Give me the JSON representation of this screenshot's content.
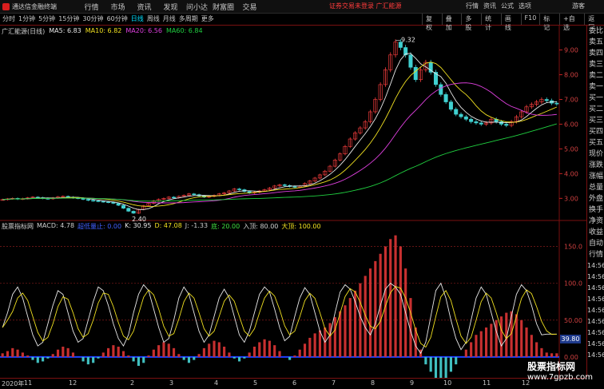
{
  "menubar": {
    "app_name": "通达信金融终端",
    "items": [
      "行情",
      "市场",
      "资讯",
      "发现",
      "问小达",
      "财富圈",
      "交易"
    ],
    "alert": "证券交易未登录",
    "alert2": "广汇能源",
    "right_items": [
      "行情",
      "资讯",
      "公式",
      "选项"
    ],
    "guest": "游客"
  },
  "toolbar": {
    "periods": [
      "分时",
      "1分钟",
      "5分钟",
      "15分钟",
      "30分钟",
      "60分钟",
      "日线",
      "周线",
      "月线",
      "多周期",
      "更多"
    ],
    "active_period": "日线",
    "tools": [
      "复权",
      "叠加",
      "多股",
      "统计",
      "画线",
      "F10",
      "标记",
      "+自选",
      "返回"
    ]
  },
  "legend": {
    "stock_name": "广汇能源(日线)",
    "ma5": "MA5: 6.83",
    "ma10": "MA10: 6.82",
    "ma20": "MA20: 6.56",
    "ma60": "MA60: 6.84"
  },
  "indicator_legend": {
    "title": "股票指标网",
    "macd": "MACD: 4.78",
    "zone": "超低量止: 0.00",
    "k": "K: 30.95",
    "d": "D: 47.08",
    "j": "J: -1.33",
    "bottom": "底: 20.00",
    "entry": "入顶: 80.00",
    "top": "大顶: 100.00"
  },
  "price_axis": [
    {
      "label": "9.00",
      "value": 9
    },
    {
      "label": "8.00",
      "value": 8
    },
    {
      "label": "7.00",
      "value": 7
    },
    {
      "label": "6.00",
      "value": 6
    },
    {
      "label": "5.00",
      "value": 5
    },
    {
      "label": "4.00",
      "value": 4
    },
    {
      "label": "3.00",
      "value": 3
    }
  ],
  "indicator_axis": [
    {
      "label": "150.0",
      "value": 150
    },
    {
      "label": "100.0",
      "value": 100
    },
    {
      "label": "50.00",
      "value": 50
    },
    {
      "label": "0.00",
      "value": 0
    }
  ],
  "annotations": {
    "high": "9.32",
    "low": "2.40",
    "readout": "39.80"
  },
  "side_tabs": [
    "委比",
    "卖五",
    "卖四",
    "卖三",
    "卖二",
    "卖一",
    "买一",
    "买二",
    "买三",
    "买四",
    "买五",
    "现价",
    "涨跌",
    "涨幅",
    "总量",
    "外盘",
    "换手",
    "净资",
    "收益",
    "自动",
    "行情"
  ],
  "side_times": [
    "14:56",
    "14:56",
    "14:56",
    "14:56",
    "14:56",
    "14:56",
    "14:56",
    "14:56",
    "14:56"
  ],
  "date_axis": [
    {
      "label": "2020年",
      "pos": 0.0
    },
    {
      "label": "11",
      "pos": 0.04
    },
    {
      "label": "12",
      "pos": 0.12
    },
    {
      "label": "2",
      "pos": 0.23
    },
    {
      "label": "3",
      "pos": 0.3
    },
    {
      "label": "4",
      "pos": 0.38
    },
    {
      "label": "5",
      "pos": 0.45
    },
    {
      "label": "6",
      "pos": 0.52
    },
    {
      "label": "7",
      "pos": 0.59
    },
    {
      "label": "8",
      "pos": 0.66
    },
    {
      "label": "9",
      "pos": 0.73
    },
    {
      "label": "10",
      "pos": 0.79
    },
    {
      "label": "11",
      "pos": 0.86
    },
    {
      "label": "12",
      "pos": 0.93
    }
  ],
  "watermark": {
    "title": "股票指标网",
    "url": "www.7gpzb.com"
  },
  "chart_data": {
    "type": "line",
    "title": "",
    "price_series": {
      "ylim": [
        2.3,
        9.6
      ],
      "close": [
        2.95,
        2.98,
        3.0,
        2.97,
        2.99,
        3.02,
        3.05,
        3.03,
        3.0,
        2.98,
        3.02,
        3.06,
        3.08,
        3.05,
        3.02,
        3.0,
        2.96,
        2.92,
        2.9,
        2.88,
        2.86,
        2.84,
        2.8,
        2.72,
        2.6,
        2.48,
        2.4,
        2.55,
        2.7,
        2.8,
        2.9,
        2.96,
        3.0,
        3.05,
        3.02,
        3.08,
        3.12,
        3.18,
        3.15,
        3.1,
        3.05,
        3.08,
        3.12,
        3.18,
        3.22,
        3.3,
        3.38,
        3.35,
        3.28,
        3.22,
        3.25,
        3.3,
        3.35,
        3.42,
        3.5,
        3.55,
        3.52,
        3.48,
        3.45,
        3.5,
        3.6,
        3.7,
        3.82,
        3.95,
        4.1,
        4.3,
        4.55,
        4.8,
        5.1,
        5.4,
        5.65,
        5.85,
        6.1,
        6.5,
        7.0,
        7.6,
        8.2,
        8.8,
        9.32,
        9.1,
        8.8,
        8.3,
        7.8,
        8.2,
        8.5,
        8.1,
        7.6,
        7.2,
        6.9,
        6.6,
        6.4,
        6.3,
        6.2,
        6.1,
        6.05,
        6.0,
        6.05,
        6.2,
        6.1,
        6.0,
        5.95,
        6.1,
        6.3,
        6.5,
        6.7,
        6.8,
        6.9,
        7.0,
        6.95,
        6.85,
        6.83
      ]
    },
    "indicator_series": {
      "ylim": [
        -25,
        170
      ],
      "k_values": [
        40,
        60,
        85,
        95,
        80,
        55,
        30,
        15,
        20,
        45,
        70,
        90,
        85,
        60,
        35,
        20,
        25,
        50,
        75,
        95,
        90,
        70,
        45,
        25,
        15,
        30,
        60,
        85,
        98,
        90,
        65,
        40,
        20,
        25,
        50,
        80,
        95,
        85,
        60,
        35,
        20,
        30,
        55,
        80,
        92,
        80,
        55,
        30,
        20,
        35,
        60,
        85,
        95,
        88,
        65,
        40,
        22,
        28,
        55,
        80,
        94,
        85,
        60,
        35,
        20,
        30,
        60,
        88,
        98,
        92,
        75,
        55,
        40,
        30,
        45,
        70,
        92,
        100,
        95,
        85,
        60,
        35,
        15,
        5,
        20,
        55,
        90,
        100,
        80,
        50,
        25,
        10,
        20,
        50,
        80,
        95,
        85,
        60,
        35,
        15,
        25,
        55,
        85,
        98,
        90,
        70,
        45,
        30,
        31,
        31,
        31
      ],
      "macd_values": [
        5,
        8,
        12,
        10,
        6,
        2,
        -4,
        -8,
        -6,
        -2,
        4,
        10,
        14,
        12,
        6,
        0,
        -6,
        -10,
        -8,
        -2,
        6,
        12,
        16,
        14,
        8,
        2,
        -6,
        -12,
        -8,
        2,
        10,
        16,
        20,
        18,
        12,
        4,
        -4,
        -8,
        -4,
        4,
        12,
        18,
        22,
        20,
        14,
        6,
        -2,
        -6,
        -2,
        6,
        14,
        20,
        24,
        22,
        16,
        8,
        0,
        -4,
        2,
        10,
        18,
        26,
        32,
        36,
        40,
        46,
        54,
        62,
        70,
        80,
        90,
        100,
        110,
        120,
        130,
        140,
        150,
        160,
        165,
        150,
        120,
        80,
        40,
        10,
        -10,
        -20,
        -30,
        -35,
        -30,
        -20,
        -10,
        0,
        10,
        20,
        30,
        35,
        40,
        45,
        50,
        55,
        60,
        62,
        58,
        50,
        40,
        30,
        20,
        12,
        6,
        5,
        5
      ]
    }
  }
}
